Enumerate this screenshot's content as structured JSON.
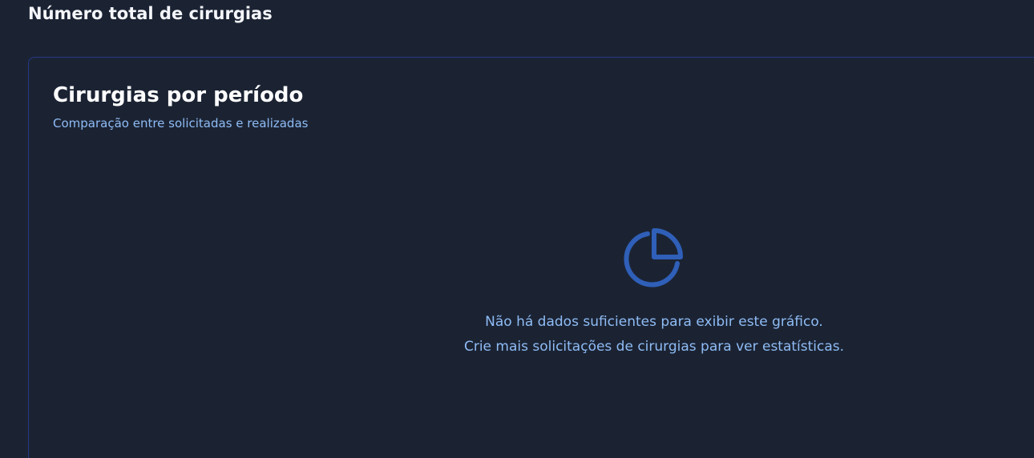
{
  "page": {
    "title": "Número total de cirurgias"
  },
  "card": {
    "title": "Cirurgias por período",
    "subtitle": "Comparação entre solicitadas e realizadas",
    "empty_state": {
      "icon": "pie-chart-icon",
      "line1": "Não há dados suficientes para exibir este gráfico.",
      "line2": "Crie mais solicitações de cirurgias para ver estatísticas."
    }
  },
  "colors": {
    "background": "#1b2333",
    "card_border": "#253a86",
    "heading": "#ffffff",
    "muted_text": "#8fbcf5",
    "icon": "#2f5fb8"
  }
}
